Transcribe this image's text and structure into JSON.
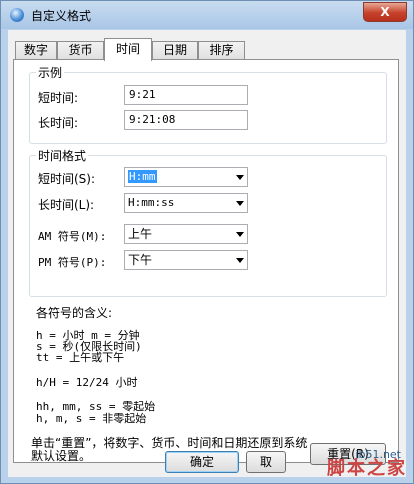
{
  "window": {
    "title": "自定义格式",
    "close_label": "X"
  },
  "tabs": [
    {
      "label": "数字"
    },
    {
      "label": "货币"
    },
    {
      "label": "时间"
    },
    {
      "label": "日期"
    },
    {
      "label": "排序"
    }
  ],
  "active_tab": "时间",
  "example": {
    "title": "示例",
    "short_label": "短时间:",
    "short_value": "9:21",
    "long_label": "长时间:",
    "long_value": "9:21:08"
  },
  "formats": {
    "title": "时间格式",
    "short_label": "短时间(S):",
    "short_value": "H:mm",
    "long_label": "长时间(L):",
    "long_value": "H:mm:ss",
    "am_label": "AM 符号(M):",
    "am_value": "上午",
    "pm_label": "PM 符号(P):",
    "pm_value": "下午"
  },
  "legend": {
    "title": "各符号的含义:",
    "line1": "h = 小时   m = 分钟",
    "line2": "s = 秒(仅限长时间)",
    "line3": "tt = 上午或下午",
    "line4": "h/H = 12/24 小时",
    "line5": "hh, mm, ss = 零起始",
    "line6": "h, m, s = 非零起始"
  },
  "reset": {
    "note": "单击“重置”，将数字、货币、时间和日期还原到系统默认设置。",
    "button": "重置(R)"
  },
  "footer": {
    "ok": "确定",
    "cancel": "取"
  },
  "watermark": {
    "site": "jb51.net",
    "brand": "脚本之家"
  }
}
